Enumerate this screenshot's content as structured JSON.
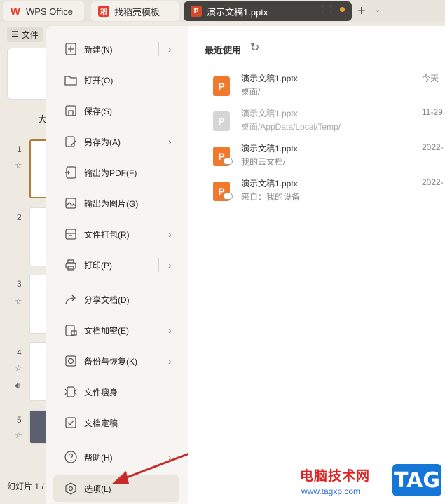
{
  "tabs": [
    {
      "label": "WPS Office",
      "icon": "wps-logo-icon"
    },
    {
      "label": "找稻壳模板",
      "icon": "docer-icon"
    },
    {
      "label": "演示文稿1.pptx",
      "icon": "ppt-icon"
    }
  ],
  "file_button": {
    "label": "文件",
    "icon": "hamburger-icon"
  },
  "partial_label": "大",
  "slides": [
    {
      "num": "1"
    },
    {
      "num": "2"
    },
    {
      "num": "3"
    },
    {
      "num": "4"
    },
    {
      "num": "5"
    }
  ],
  "status_bar": {
    "text": "幻灯片 1 /"
  },
  "menu": {
    "items": [
      {
        "label": "新建(N)",
        "icon": "new-file-icon"
      },
      {
        "label": "打开(O)",
        "icon": "open-folder-icon"
      },
      {
        "label": "保存(S)",
        "icon": "save-icon"
      },
      {
        "label": "另存为(A)",
        "icon": "save-as-icon"
      },
      {
        "label": "输出为PDF(F)",
        "icon": "export-pdf-icon"
      },
      {
        "label": "输出为图片(G)",
        "icon": "export-image-icon"
      },
      {
        "label": "文件打包(R)",
        "icon": "package-icon"
      },
      {
        "label": "打印(P)",
        "icon": "print-icon"
      },
      {
        "label": "分享文档(D)",
        "icon": "share-icon"
      },
      {
        "label": "文档加密(E)",
        "icon": "encrypt-icon"
      },
      {
        "label": "备份与恢复(K)",
        "icon": "backup-icon"
      },
      {
        "label": "文件瘦身",
        "icon": "slim-icon"
      },
      {
        "label": "文档定稿",
        "icon": "finalize-icon"
      },
      {
        "label": "帮助(H)",
        "icon": "help-icon"
      },
      {
        "label": "选项(L)",
        "icon": "options-icon"
      }
    ]
  },
  "recent": {
    "title": "最近使用",
    "files": [
      {
        "name": "演示文稿1.pptx",
        "path": "桌面/",
        "date": "今天"
      },
      {
        "name": "演示文稿1.pptx",
        "path": "桌面/AppData/Local/Temp/",
        "date": "11-29"
      },
      {
        "name": "演示文稿1.pptx",
        "path": "我的云文档/",
        "date": "2022-"
      },
      {
        "name": "演示文稿1.pptx",
        "path": "来自：我的设备",
        "date": "2022-"
      }
    ]
  },
  "watermark": {
    "site_name": "电脑技术网",
    "url": "www.tagxp.com",
    "tag": "TAG"
  }
}
